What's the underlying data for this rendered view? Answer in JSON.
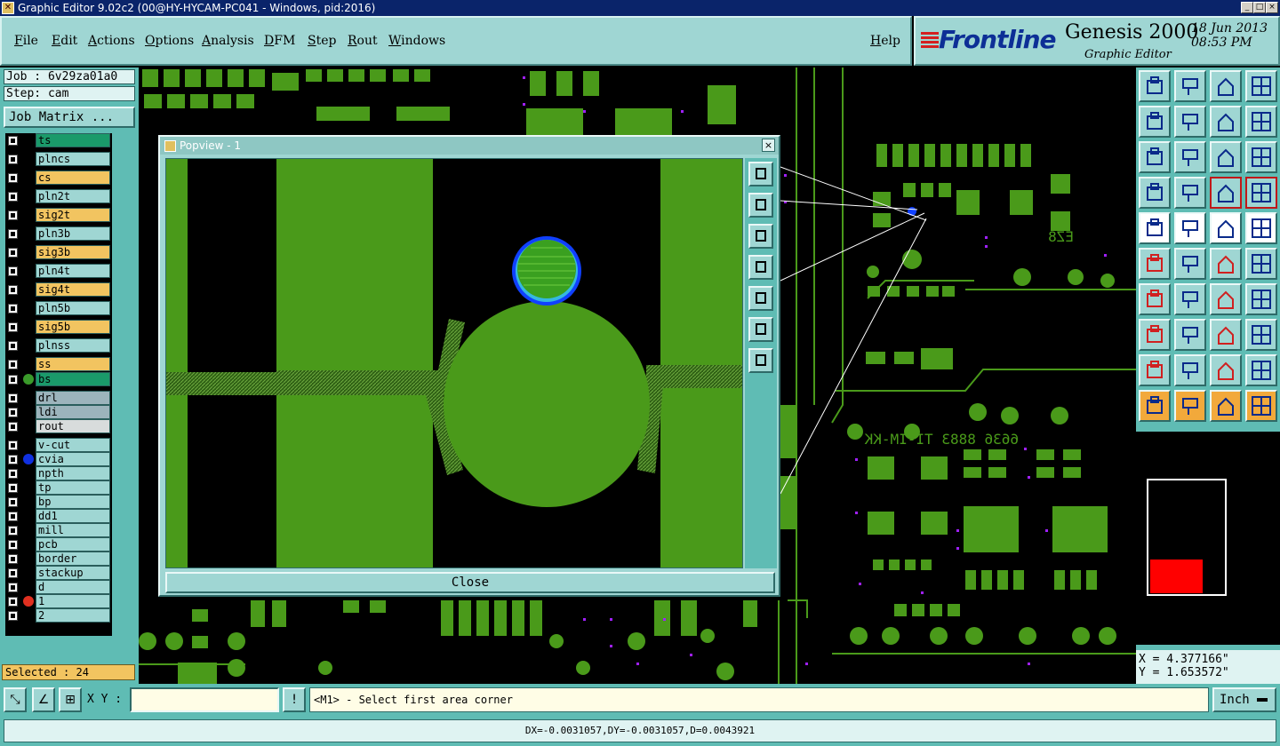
{
  "window": {
    "title": "Graphic Editor 9.02c2 (00@HY-HYCAM-PC041 - Windows, pid:2016)",
    "controls": [
      "_",
      "□",
      "×"
    ]
  },
  "menu": {
    "items": [
      "File",
      "Edit",
      "Actions",
      "Options",
      "Analysis",
      "DFM",
      "Step",
      "Rout",
      "Windows"
    ],
    "help": "Help"
  },
  "brand": {
    "logo": "Frontline",
    "product": "Genesis 2000",
    "subtitle": "Graphic Editor",
    "date": "18 Jun 2013",
    "time": "08:53 PM"
  },
  "job": {
    "job_label": "Job : 6v29za01a0",
    "step_label": "Step: cam",
    "matrix_button": "Job Matrix ..."
  },
  "layers": [
    {
      "name": "ts",
      "color": "#1a9a6a"
    },
    {
      "name": "plncs",
      "color": "#9fd6d3"
    },
    {
      "name": "cs",
      "color": "#f2c460"
    },
    {
      "name": "pln2t",
      "color": "#9fd6d3"
    },
    {
      "name": "sig2t",
      "color": "#f2c460"
    },
    {
      "name": "pln3b",
      "color": "#9fd6d3"
    },
    {
      "name": "sig3b",
      "color": "#f2c460"
    },
    {
      "name": "pln4t",
      "color": "#9fd6d3"
    },
    {
      "name": "sig4t",
      "color": "#f2c460"
    },
    {
      "name": "pln5b",
      "color": "#9fd6d3"
    },
    {
      "name": "sig5b",
      "color": "#f2c460"
    },
    {
      "name": "plnss",
      "color": "#9fd6d3"
    },
    {
      "name": "ss",
      "color": "#f2c460"
    },
    {
      "name": "bs",
      "color": "#1a9a6a",
      "dot": "#3a9a2a"
    },
    {
      "name": "drl",
      "color": "#9cb4bc"
    },
    {
      "name": "ldi",
      "color": "#9cb4bc"
    },
    {
      "name": "rout",
      "color": "#d8dcdc"
    },
    {
      "name": "v-cut",
      "color": "#9fd6d3"
    },
    {
      "name": "cvia",
      "color": "#9fd6d3",
      "dot": "#1030e0"
    },
    {
      "name": "npth",
      "color": "#9fd6d3"
    },
    {
      "name": "tp",
      "color": "#9fd6d3"
    },
    {
      "name": "bp",
      "color": "#9fd6d3"
    },
    {
      "name": "dd1",
      "color": "#9fd6d3"
    },
    {
      "name": "mill",
      "color": "#9fd6d3"
    },
    {
      "name": "pcb",
      "color": "#9fd6d3"
    },
    {
      "name": "border",
      "color": "#9fd6d3"
    },
    {
      "name": "stackup",
      "color": "#9fd6d3"
    },
    {
      "name": "d",
      "color": "#9fd6d3"
    },
    {
      "name": "1",
      "color": "#9fd6d3",
      "dot": "#e03020"
    },
    {
      "name": "2",
      "color": "#9fd6d3"
    }
  ],
  "selected": "Selected : 24",
  "popview": {
    "title": "Popview - 1",
    "close_button": "Close",
    "close_icon": "×"
  },
  "board_text": {
    "silk_1": "6636 8883 TI-IM-KK",
    "silk_2": "EZ8"
  },
  "colors": {
    "copper": "#4a9a1a",
    "panel": "#9fd6d3",
    "panel_dark": "#5fbcb4",
    "drill": "#a020ff",
    "highlight": "#1040ff"
  },
  "coords": {
    "x": "X = 4.377166\"",
    "y": "Y = 1.653572\""
  },
  "command": {
    "xy_label": "X Y :",
    "xy_value": "",
    "warn_icon": "!",
    "prompt": "<M1> - Select first area corner",
    "units": "Inch"
  },
  "status": {
    "text": "DX=-0.0031057,DY=-0.0031057,D=0.0043921"
  }
}
